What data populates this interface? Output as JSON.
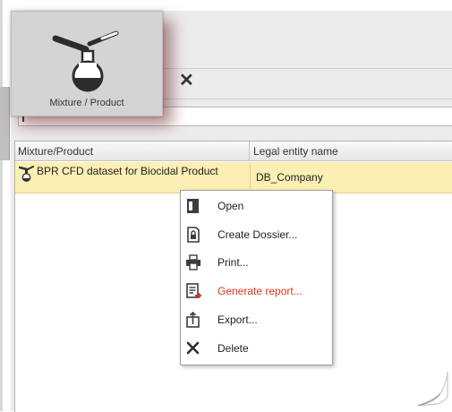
{
  "toolbar": {
    "big_button_label": "Mixture / Product",
    "close_symbol": "✕"
  },
  "table": {
    "columns": [
      "Mixture/Product",
      "Legal entity name"
    ],
    "rows": [
      {
        "name": "BPR CFD dataset for Biocidal Product",
        "legal_entity": "DB_Company"
      }
    ]
  },
  "context_menu": {
    "items": [
      {
        "label": "Open",
        "icon": "open-icon",
        "style": "normal"
      },
      {
        "label": "Create Dossier...",
        "icon": "create-dossier-icon",
        "style": "normal"
      },
      {
        "label": "Print...",
        "icon": "print-icon",
        "style": "normal"
      },
      {
        "label": "Generate report...",
        "icon": "generate-report-icon",
        "style": "highlight"
      },
      {
        "label": "Export...",
        "icon": "export-icon",
        "style": "normal"
      },
      {
        "label": "Delete",
        "icon": "delete-icon",
        "style": "normal"
      }
    ]
  },
  "colors": {
    "selected_row": "#fcefb4",
    "highlight_text": "#d9381e",
    "button_glow": "#6e2828"
  }
}
